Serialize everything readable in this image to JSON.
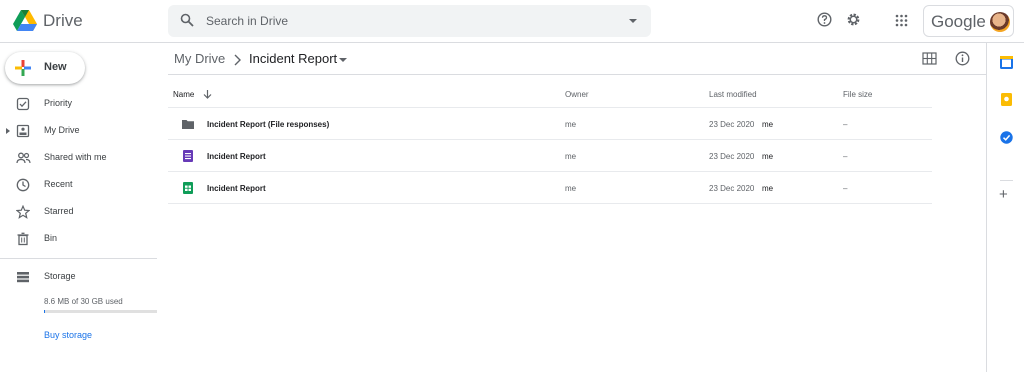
{
  "app": {
    "name": "Drive"
  },
  "search": {
    "placeholder": "Search in Drive"
  },
  "account": {
    "brand_word": "Google"
  },
  "sidebar": {
    "new_label": "New",
    "items": [
      {
        "label": "Priority",
        "icon": "priority-icon"
      },
      {
        "label": "My Drive",
        "icon": "my-drive-icon"
      },
      {
        "label": "Shared with me",
        "icon": "shared-icon"
      },
      {
        "label": "Recent",
        "icon": "clock-icon"
      },
      {
        "label": "Starred",
        "icon": "star-icon"
      },
      {
        "label": "Bin",
        "icon": "bin-icon"
      }
    ],
    "storage": {
      "label": "Storage",
      "used_text": "8.6 MB of 30 GB used",
      "used_fraction": 0.0003,
      "buy_label": "Buy storage"
    }
  },
  "breadcrumb": {
    "root": "My Drive",
    "separator": ">",
    "current": "Incident Report"
  },
  "table": {
    "columns": {
      "name": "Name",
      "owner": "Owner",
      "modified": "Last modified",
      "size": "File size"
    },
    "rows": [
      {
        "name": "Incident Report (File responses)",
        "type": "folder-icon",
        "owner": "me",
        "date": "23 Dec 2020",
        "by": "me",
        "size": "–"
      },
      {
        "name": "Incident Report",
        "type": "forms-icon",
        "owner": "me",
        "date": "23 Dec 2020",
        "by": "me",
        "size": "–"
      },
      {
        "name": "Incident Report",
        "type": "sheets-icon",
        "owner": "me",
        "date": "23 Dec 2020",
        "by": "me",
        "size": "–"
      }
    ]
  },
  "colors": {
    "accent": "#1a73e8",
    "forms": "#673ab7",
    "sheets": "#0f9d58",
    "folder": "#5f6368"
  }
}
